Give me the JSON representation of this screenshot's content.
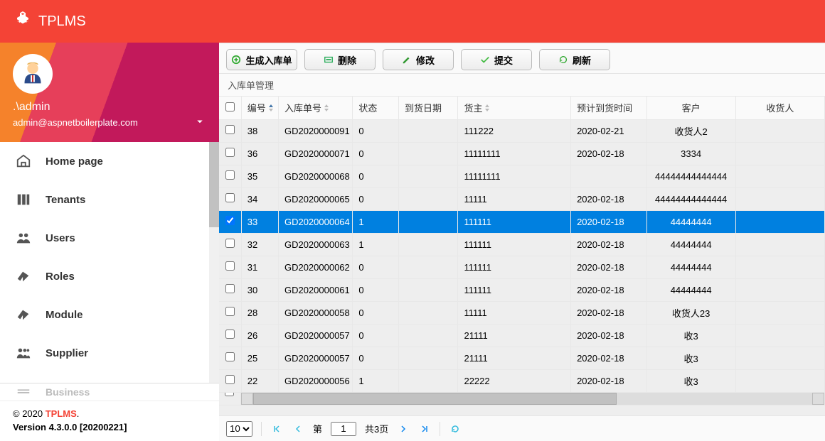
{
  "app_title": "TPLMS",
  "user": {
    "name": ".\\admin",
    "email": "admin@aspnetboilerplate.com"
  },
  "sidebar": {
    "items": [
      {
        "label": "Home page"
      },
      {
        "label": "Tenants"
      },
      {
        "label": "Users"
      },
      {
        "label": "Roles"
      },
      {
        "label": "Module"
      },
      {
        "label": "Supplier"
      }
    ],
    "cutoff_label": "Business"
  },
  "footer": {
    "copyright": "© 2020 ",
    "brand": "TPLMS",
    "dot": ".",
    "version": "Version 4.3.0.0 [20200221]"
  },
  "toolbar": {
    "create": "生成入库单",
    "delete": "删除",
    "edit": "修改",
    "submit": "提交",
    "refresh": "刷新"
  },
  "panel_title": "入库单管理",
  "columns": {
    "id": "编号",
    "no": "入库单号",
    "status": "状态",
    "date": "到货日期",
    "owner": "货主",
    "eta": "预计到货时间",
    "customer": "客户",
    "receiver": "收货人"
  },
  "rows": [
    {
      "sel": false,
      "id": "38",
      "no": "GD2020000091",
      "status": "0",
      "date": "",
      "owner": "111222",
      "eta": "2020-02-21",
      "customer": "收货人2",
      "receiver": ""
    },
    {
      "sel": false,
      "id": "36",
      "no": "GD2020000071",
      "status": "0",
      "date": "",
      "owner": "11111111",
      "eta": "2020-02-18",
      "customer": "3334",
      "receiver": ""
    },
    {
      "sel": false,
      "id": "35",
      "no": "GD2020000068",
      "status": "0",
      "date": "",
      "owner": "11111111",
      "eta": "",
      "customer": "44444444444444",
      "receiver": ""
    },
    {
      "sel": false,
      "id": "34",
      "no": "GD2020000065",
      "status": "0",
      "date": "",
      "owner": "11111",
      "eta": "2020-02-18",
      "customer": "44444444444444",
      "receiver": ""
    },
    {
      "sel": true,
      "id": "33",
      "no": "GD2020000064",
      "status": "1",
      "date": "",
      "owner": "111111",
      "eta": "2020-02-18",
      "customer": "44444444",
      "receiver": ""
    },
    {
      "sel": false,
      "id": "32",
      "no": "GD2020000063",
      "status": "1",
      "date": "",
      "owner": "111111",
      "eta": "2020-02-18",
      "customer": "44444444",
      "receiver": ""
    },
    {
      "sel": false,
      "id": "31",
      "no": "GD2020000062",
      "status": "0",
      "date": "",
      "owner": "111111",
      "eta": "2020-02-18",
      "customer": "44444444",
      "receiver": ""
    },
    {
      "sel": false,
      "id": "30",
      "no": "GD2020000061",
      "status": "0",
      "date": "",
      "owner": "111111",
      "eta": "2020-02-18",
      "customer": "44444444",
      "receiver": ""
    },
    {
      "sel": false,
      "id": "28",
      "no": "GD2020000058",
      "status": "0",
      "date": "",
      "owner": "11111",
      "eta": "2020-02-18",
      "customer": "收货人23",
      "receiver": ""
    },
    {
      "sel": false,
      "id": "26",
      "no": "GD2020000057",
      "status": "0",
      "date": "",
      "owner": "21111",
      "eta": "2020-02-18",
      "customer": "收3",
      "receiver": ""
    },
    {
      "sel": false,
      "id": "25",
      "no": "GD2020000057",
      "status": "0",
      "date": "",
      "owner": "21111",
      "eta": "2020-02-18",
      "customer": "收3",
      "receiver": ""
    },
    {
      "sel": false,
      "id": "22",
      "no": "GD2020000056",
      "status": "1",
      "date": "",
      "owner": "22222",
      "eta": "2020-02-18",
      "customer": "收3",
      "receiver": ""
    }
  ],
  "pager": {
    "page_size": "10",
    "page_label_prefix": "第",
    "page_value": "1",
    "total_pages": "共3页"
  }
}
